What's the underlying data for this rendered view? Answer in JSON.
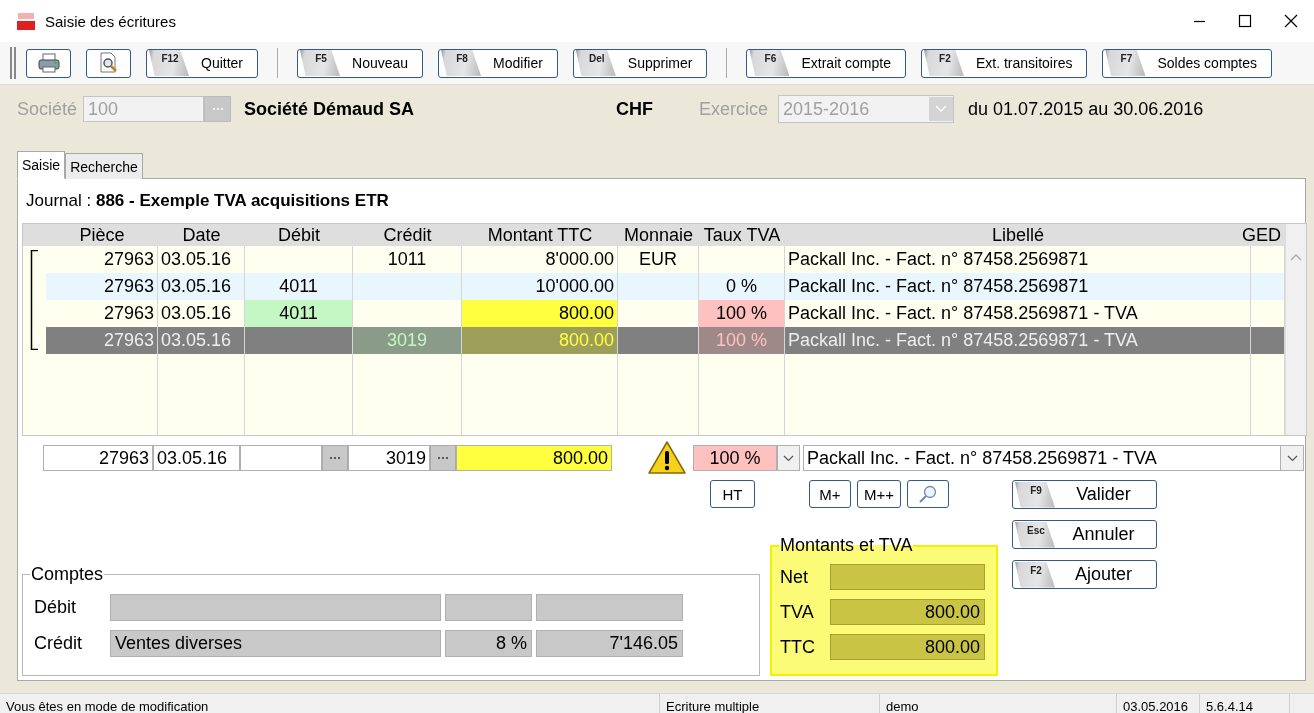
{
  "window": {
    "title": "Saisie des écritures"
  },
  "toolbar": [
    {
      "kind": "print"
    },
    {
      "kind": "preview"
    },
    {
      "kind": "key",
      "key": "F12",
      "label": "Quitter"
    },
    {
      "kind": "separator"
    },
    {
      "kind": "key",
      "key": "F5",
      "label": "Nouveau"
    },
    {
      "kind": "key",
      "key": "F8",
      "label": "Modifier"
    },
    {
      "kind": "key",
      "key": "Del",
      "label": "Supprimer"
    },
    {
      "kind": "separator"
    },
    {
      "kind": "key",
      "key": "F6",
      "label": "Extrait compte"
    },
    {
      "kind": "key",
      "key": "F2",
      "label": "Ext. transitoires"
    },
    {
      "kind": "key",
      "key": "F7",
      "label": "Soldes comptes"
    }
  ],
  "company": {
    "label": "Société",
    "code": "100",
    "disabled": true,
    "name": "Société Démaud SA",
    "currency": "CHF",
    "year_label": "Exercice",
    "year": "2015-2016",
    "year_disabled": true,
    "period": "du 01.07.2015 au 30.06.2016"
  },
  "tabs": [
    {
      "label": "Saisie",
      "selected": true
    },
    {
      "label": "Recherche",
      "selected": false
    }
  ],
  "journal": "Journal : **886 - Exemple  TVA acquisitions ETR**",
  "table": {
    "columns": [
      "Pièce",
      "Date",
      "Débit",
      "Crédit",
      "Montant TTC",
      "Monnaie",
      "Taux TVA",
      "Libellé",
      "GED"
    ],
    "rows": [
      {
        "piece": "27963",
        "date": "03.05.16",
        "credit": "1011",
        "montant": "8'000.00",
        "monnaie": "EUR",
        "libelle": "Packall Inc. - Fact. n° 87458.2569871",
        "selected": false,
        "color": "#fffff0",
        "debit_highlighted": false,
        "credit_highlighted": false,
        "montant_highlighted": false,
        "taux_highlighted": false
      },
      {
        "piece": "27963",
        "date": "03.05.16",
        "debit": "4011",
        "montant": "10'000.00",
        "taux": "0 %",
        "libelle": "Packall Inc. - Fact. n° 87458.2569871",
        "selected": false,
        "color": "#eaf6fd",
        "debit_highlighted": false,
        "credit_highlighted": false,
        "montant_highlighted": false,
        "taux_highlighted": false
      },
      {
        "piece": "27963",
        "date": "03.05.16",
        "debit": "4011",
        "montant": "800.00",
        "taux": "100 %",
        "libelle": "Packall Inc. - Fact. n° 87458.2569871 - TVA",
        "selected": false,
        "color": "#fffff0",
        "debit_highlighted": true,
        "credit_highlighted": false,
        "montant_highlighted": true,
        "taux_highlighted": true
      },
      {
        "piece": "27963",
        "date": "03.05.16",
        "credit": "3019",
        "montant": "800.00",
        "taux": "100 %",
        "libelle": "Packall Inc. - Fact. n° 87458.2569871 - TVA",
        "selected": true,
        "debit_highlighted": false,
        "credit_highlighted": true,
        "montant_highlighted": true,
        "taux_highlighted": true
      }
    ]
  },
  "editor": {
    "piece": "27963",
    "date": "03.05.16",
    "credit": "3019",
    "montant": "800.00",
    "taux": "100 %",
    "libelle": "Packall Inc. - Fact. n° 87458.2569871 - TVA",
    "warning": true,
    "montant_highlighted": true,
    "taux_highlighted": true
  },
  "tools": [
    {
      "kind": "text",
      "label": "HT"
    },
    {
      "kind": "text",
      "label": "M+"
    },
    {
      "kind": "text",
      "label": "M++"
    },
    {
      "kind": "search"
    }
  ],
  "actions": [
    {
      "key": "F9",
      "label": "Valider"
    },
    {
      "key": "Esc",
      "label": "Annuler"
    },
    {
      "key": "F2",
      "label": "Ajouter"
    }
  ],
  "accounts": {
    "title": "Comptes",
    "rows": [
      {
        "label": "Débit"
      },
      {
        "label": "Crédit",
        "name": "Ventes diverses",
        "rate": "8 %",
        "balance": "7'146.05"
      }
    ]
  },
  "totals": {
    "title": "Montants et TVA",
    "rows": [
      {
        "label": "Net"
      },
      {
        "label": "TVA",
        "value": "800.00"
      },
      {
        "label": "TTC",
        "value": "800.00"
      }
    ]
  },
  "status_bar": [
    "Vous êtes en mode de modification",
    "Ecriture multiple",
    "demo",
    "03.05.2016",
    "5.6.4.14"
  ]
}
